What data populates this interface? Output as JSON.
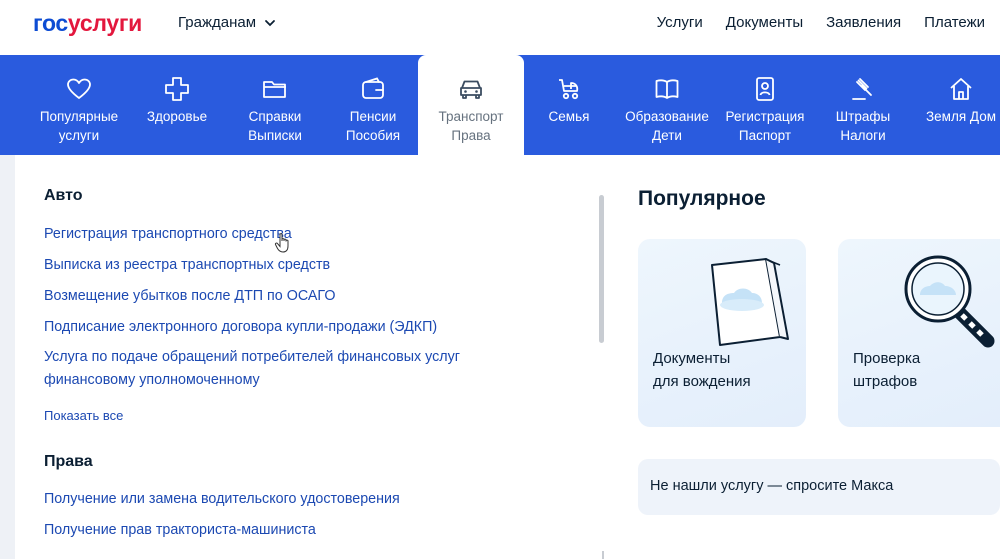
{
  "header": {
    "logo_part1": "гос",
    "logo_part2": "услуги",
    "audience": "Гражданам",
    "nav": [
      "Услуги",
      "Документы",
      "Заявления",
      "Платежи"
    ]
  },
  "categories": [
    {
      "line1": "Популярные",
      "line2": "услуги",
      "icon": "heart-icon"
    },
    {
      "line1": "Здоровье",
      "line2": "",
      "icon": "plus-icon"
    },
    {
      "line1": "Справки",
      "line2": "Выписки",
      "icon": "folder-icon"
    },
    {
      "line1": "Пенсии",
      "line2": "Пособия",
      "icon": "wallet-icon"
    },
    {
      "line1": "Транспорт",
      "line2": "Права",
      "icon": "car-icon",
      "active": true
    },
    {
      "line1": "Семья",
      "line2": "",
      "icon": "stroller-icon"
    },
    {
      "line1": "Образование",
      "line2": "Дети",
      "icon": "book-icon"
    },
    {
      "line1": "Регистрация",
      "line2": "Паспорт",
      "icon": "id-card-icon"
    },
    {
      "line1": "Штрафы",
      "line2": "Налоги",
      "icon": "gavel-icon"
    },
    {
      "line1": "Земля Дом",
      "line2": "",
      "icon": "house-icon"
    }
  ],
  "auto": {
    "title": "Авто",
    "links": [
      "Регистрация транспортного средства",
      "Выписка из реестра транспортных средств",
      "Возмещение убытков после ДТП по ОСАГО",
      "Подписание электронного договора купли-продажи (ЭДКП)",
      "Услуга по подаче обращений потребителей финансовых услуг финансовому уполномоченному"
    ],
    "show_all": "Показать все"
  },
  "rights": {
    "title": "Права",
    "links": [
      "Получение или замена водительского удостоверения",
      "Получение прав тракториста-машиниста"
    ]
  },
  "popular": {
    "title": "Популярное",
    "cards": [
      {
        "line1": "Документы",
        "line2": "для вождения"
      },
      {
        "line1": "Проверка",
        "line2": "штрафов"
      }
    ],
    "ask": "Не нашли услугу — спросите Макса"
  },
  "colors": {
    "brand_blue": "#2a5bde",
    "logo_blue": "#0d4cd3",
    "logo_red": "#e3173d",
    "link": "#1c49b2"
  }
}
